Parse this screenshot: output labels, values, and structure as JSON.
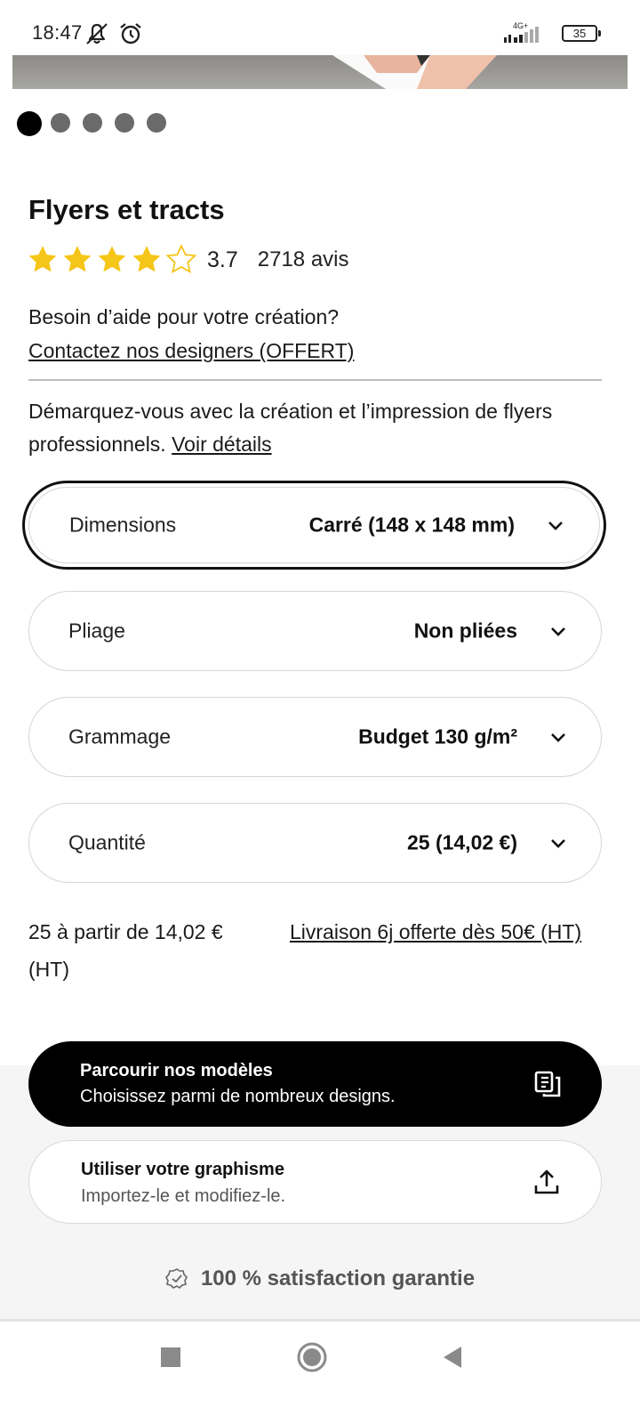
{
  "status_bar": {
    "time": "18:47",
    "network": "4G+",
    "battery": "35",
    "icons": [
      "bell-off-icon",
      "alarm-icon",
      "signal-icon",
      "battery-icon"
    ]
  },
  "carousel": {
    "slide_count": 5,
    "active_index": 0
  },
  "product": {
    "title": "Flyers et tracts",
    "rating": "3.7",
    "rating_stars": 3.7,
    "review_count": "2718 avis"
  },
  "help": {
    "text": "Besoin d’aide pour votre création?",
    "link": "Contactez nos designers (OFFERT)"
  },
  "description": {
    "text": "Démarquez-vous avec la création et l’impression de flyers professionnels.",
    "link": "Voir détails"
  },
  "options": [
    {
      "label": "Dimensions",
      "value": "Carré (148 x 148 mm)"
    },
    {
      "label": "Pliage",
      "value": "Non pliées"
    },
    {
      "label": "Grammage",
      "value": "Budget 130 g/m²"
    },
    {
      "label": "Quantité",
      "value": "25 (14,02 €)"
    }
  ],
  "pricing": {
    "note": "25 à partir de 14,02 € (HT)",
    "delivery_link": "Livraison 6j offerte dès 50€ (HT)"
  },
  "actions": {
    "browse": {
      "title": "Parcourir nos modèles",
      "subtitle": "Choisissez parmi de nombreux designs.",
      "icon": "templates-icon"
    },
    "upload": {
      "title": "Utiliser votre graphisme",
      "subtitle": "Importez-le et modifiez-le.",
      "icon": "upload-icon"
    }
  },
  "guarantee": {
    "text": "100 % satisfaction garantie",
    "icon": "check-badge-icon"
  },
  "nav": {
    "buttons": [
      "recents-button",
      "home-button",
      "back-button"
    ]
  },
  "colors": {
    "star": "#f5c518",
    "primary_button": "#000000",
    "panel_bg": "#f5f5f5"
  }
}
